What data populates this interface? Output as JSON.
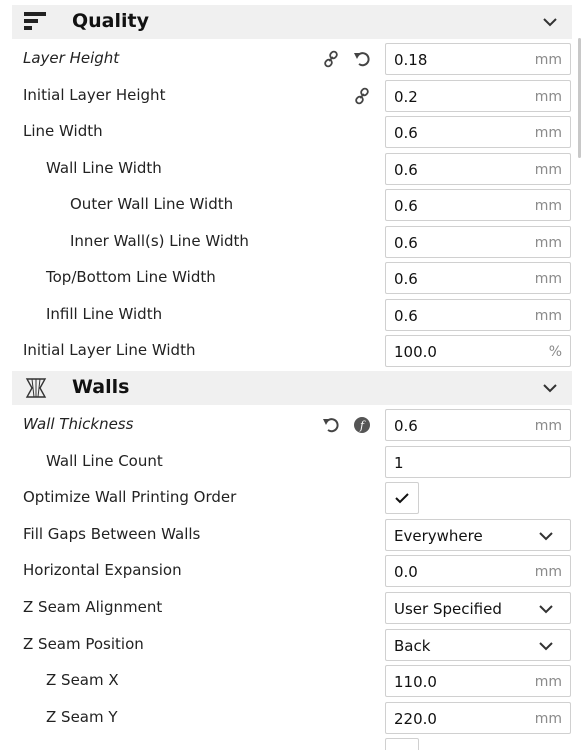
{
  "quality": {
    "title": "Quality",
    "header_icon": "quality-icon",
    "rows": [
      {
        "label": "Layer Height",
        "value": "0.18",
        "unit": "mm"
      },
      {
        "label": "Initial Layer Height",
        "value": "0.2",
        "unit": "mm"
      },
      {
        "label": "Line Width",
        "value": "0.6",
        "unit": "mm"
      },
      {
        "label": "Wall Line Width",
        "value": "0.6",
        "unit": "mm"
      },
      {
        "label": "Outer Wall Line Width",
        "value": "0.6",
        "unit": "mm"
      },
      {
        "label": "Inner Wall(s) Line Width",
        "value": "0.6",
        "unit": "mm"
      },
      {
        "label": "Top/Bottom Line Width",
        "value": "0.6",
        "unit": "mm"
      },
      {
        "label": "Infill Line Width",
        "value": "0.6",
        "unit": "mm"
      },
      {
        "label": "Initial Layer Line Width",
        "value": "100.0",
        "unit": "%"
      }
    ]
  },
  "walls": {
    "title": "Walls",
    "header_icon": "walls-icon",
    "rows": [
      {
        "label": "Wall Thickness",
        "value": "0.6",
        "unit": "mm"
      },
      {
        "label": "Wall Line Count",
        "value": "1",
        "unit": ""
      },
      {
        "label": "Optimize Wall Printing Order",
        "checked": true
      },
      {
        "label": "Fill Gaps Between Walls",
        "value": "Everywhere"
      },
      {
        "label": "Horizontal Expansion",
        "value": "0.0",
        "unit": "mm"
      },
      {
        "label": "Z Seam Alignment",
        "value": "User Specified"
      },
      {
        "label": "Z Seam Position",
        "value": "Back"
      },
      {
        "label": "Z Seam X",
        "value": "110.0",
        "unit": "mm"
      },
      {
        "label": "Z Seam Y",
        "value": "220.0",
        "unit": "mm"
      }
    ]
  },
  "icons": {
    "link": "link-icon",
    "reset": "reset-icon",
    "function": "function-icon",
    "chevron": "chevron-down-icon",
    "check": "checkmark-icon"
  }
}
